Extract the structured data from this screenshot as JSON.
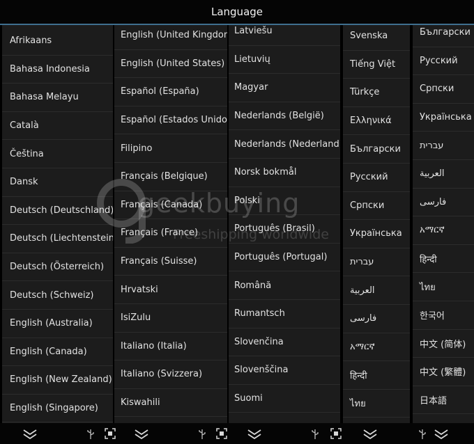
{
  "header": {
    "title": "Language"
  },
  "columns": [
    {
      "items": [
        "Afrikaans",
        "Bahasa Indonesia",
        "Bahasa Melayu",
        "Català",
        "Čeština",
        "Dansk",
        "Deutsch (Deutschland)",
        "Deutsch (Liechtenstein)",
        "Deutsch (Österreich)",
        "Deutsch (Schweiz)",
        "English (Australia)",
        "English (Canada)",
        "English (New Zealand)",
        "English (Singapore)"
      ]
    },
    {
      "items": [
        "English (United Kingdom)",
        "English (United States)",
        "Español (España)",
        "Español (Estados Unidos)",
        "Filipino",
        "Français (Belgique)",
        "Français (Canada)",
        "Français (France)",
        "Français (Suisse)",
        "Hrvatski",
        "IsiZulu",
        "Italiano (Italia)",
        "Italiano (Svizzera)",
        "Kiswahili"
      ]
    },
    {
      "items": [
        "Latviešu",
        "Lietuvių",
        "Magyar",
        "Nederlands (België)",
        "Nederlands (Nederland)",
        "Norsk bokmål",
        "Polski",
        "Português (Brasil)",
        "Português (Portugal)",
        "Română",
        "Rumantsch",
        "Slovenčina",
        "Slovenščina",
        "Suomi"
      ]
    },
    {
      "items": [
        "Svenska",
        "Tiếng Việt",
        "Türkçe",
        "Ελληνικά",
        "Български",
        "Русский",
        "Српски",
        "Українська",
        "עברית",
        "العربية",
        "فارسی",
        "አማርኛ",
        "हिन्दी",
        "ไทย"
      ]
    },
    {
      "items": [
        "Български",
        "Русский",
        "Српски",
        "Українська",
        "עברית",
        "العربية",
        "فارسی",
        "አማርኛ",
        "हिन्दी",
        "ไทย",
        "한국어",
        "中文 (简体)",
        "中文 (繁體)",
        "日本語"
      ]
    }
  ],
  "watermark": {
    "brand": "geekbuying",
    "tagline": "Freeshipping worldwide"
  },
  "colors": {
    "accent": "#3f6f8f",
    "panel": "#1c1c1c",
    "background": "#000000"
  },
  "navbar": {
    "icons": [
      "chevron-down-icon",
      "usb-icon",
      "screenshot-icon"
    ]
  }
}
